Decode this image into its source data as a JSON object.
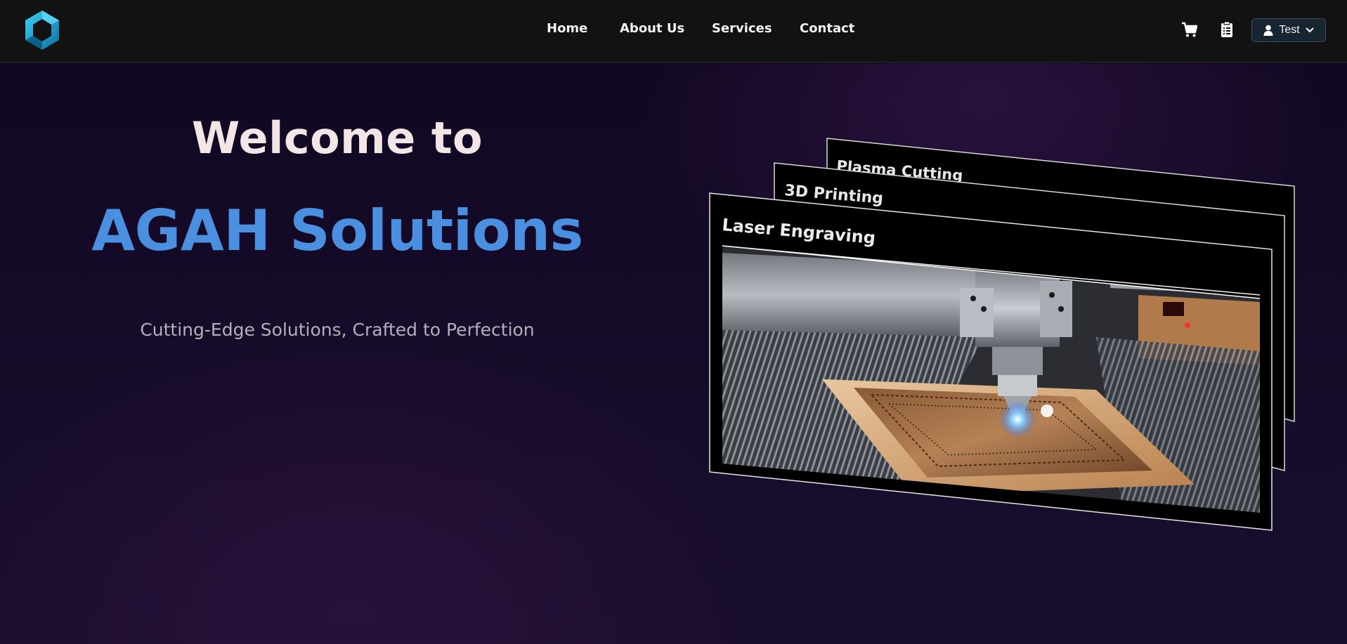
{
  "nav": {
    "links": [
      {
        "label": "Home"
      },
      {
        "label": "About Us"
      },
      {
        "label": "Services"
      },
      {
        "label": "Contact"
      }
    ],
    "cart_icon": "cart-icon",
    "orders_icon": "clipboard-icon",
    "user": {
      "label": "Test",
      "icon": "user-icon",
      "chevron": "chevron-down-icon"
    }
  },
  "hero": {
    "welcome": "Welcome to",
    "brand": "AGAH Solutions",
    "tagline": "Cutting-Edge Solutions, Crafted to Perfection"
  },
  "services": [
    {
      "title": "Plasma Cutting"
    },
    {
      "title": "3D Printing"
    },
    {
      "title": "Laser Engraving"
    }
  ],
  "colors": {
    "navbar_bg": "#121212",
    "brand_blue": "#4a8fe0",
    "logo_cyan": "#1fa7d6",
    "hero_bg": "#150b28"
  }
}
